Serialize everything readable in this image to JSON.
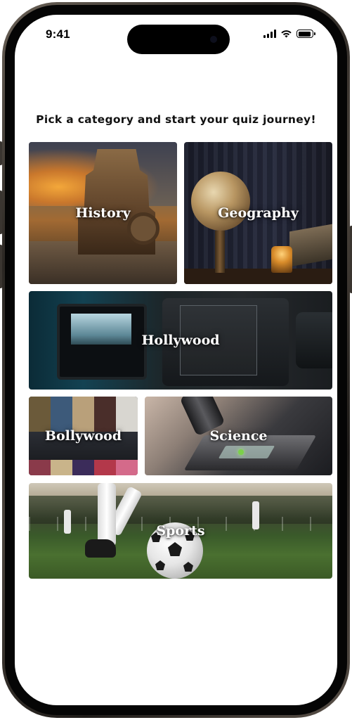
{
  "status_bar": {
    "time": "9:41"
  },
  "headline": "Pick a category and start your quiz journey!",
  "categories": [
    {
      "label": "History"
    },
    {
      "label": "Geography"
    },
    {
      "label": "Hollywood"
    },
    {
      "label": "Bollywood"
    },
    {
      "label": "Science"
    },
    {
      "label": "Sports"
    }
  ],
  "icons": {
    "signal": "cellular-signal-icon",
    "wifi": "wifi-icon",
    "battery": "battery-icon"
  },
  "colors": {
    "label_text": "#ffffff",
    "headline_text": "#111111",
    "background": "#ffffff"
  },
  "status": {
    "battery_level": 0.9
  }
}
